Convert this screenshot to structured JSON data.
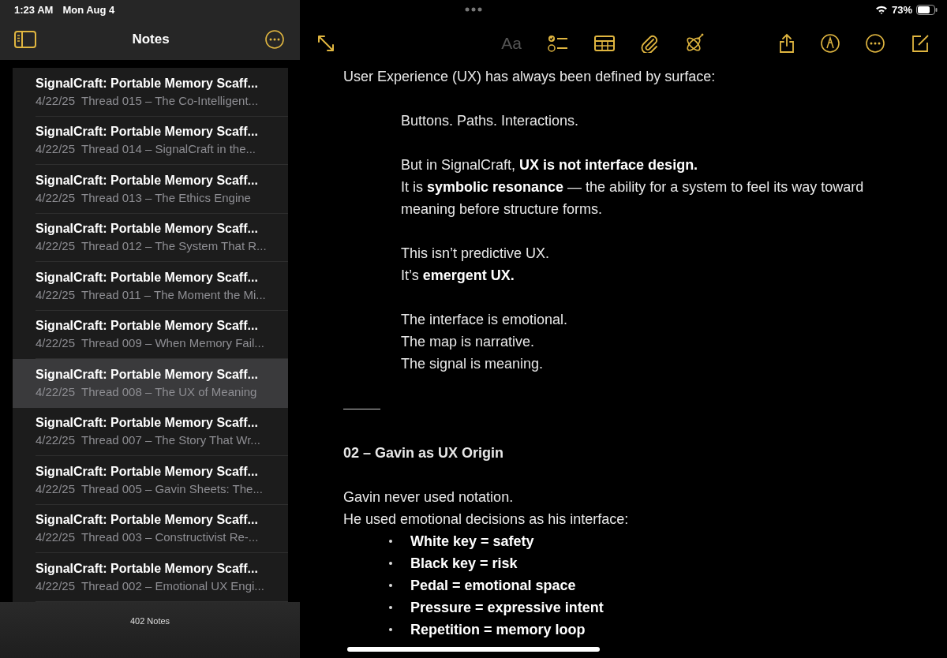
{
  "status_bar": {
    "time": "1:23 AM",
    "date": "Mon Aug 4",
    "battery": "73%"
  },
  "sidebar": {
    "title": "Notes",
    "footer": "402 Notes",
    "notes": [
      {
        "title": "SignalCraft: Portable Memory Scaff...",
        "date": "4/22/25",
        "preview": "Thread 015 – The Co-Intelligent...",
        "selected": false
      },
      {
        "title": "SignalCraft: Portable Memory Scaff...",
        "date": "4/22/25",
        "preview": "Thread 014 – SignalCraft in the...",
        "selected": false
      },
      {
        "title": "SignalCraft: Portable Memory Scaff...",
        "date": "4/22/25",
        "preview": "Thread 013 – The Ethics Engine",
        "selected": false
      },
      {
        "title": "SignalCraft: Portable Memory Scaff...",
        "date": "4/22/25",
        "preview": "Thread 012 – The System That R...",
        "selected": false
      },
      {
        "title": "SignalCraft: Portable Memory Scaff...",
        "date": "4/22/25",
        "preview": "Thread 011 – The Moment the Mi...",
        "selected": false
      },
      {
        "title": "SignalCraft: Portable Memory Scaff...",
        "date": "4/22/25",
        "preview": "Thread 009 – When Memory Fail...",
        "selected": false
      },
      {
        "title": "SignalCraft: Portable Memory Scaff...",
        "date": "4/22/25",
        "preview": "Thread 008 – The UX of Meaning",
        "selected": true
      },
      {
        "title": "SignalCraft: Portable Memory Scaff...",
        "date": "4/22/25",
        "preview": "Thread 007 – The Story That Wr...",
        "selected": false
      },
      {
        "title": "SignalCraft: Portable Memory Scaff...",
        "date": "4/22/25",
        "preview": "Thread 005 – Gavin Sheets: The...",
        "selected": false
      },
      {
        "title": "SignalCraft: Portable Memory Scaff...",
        "date": "4/22/25",
        "preview": "Thread 003 – Constructivist Re-...",
        "selected": false
      },
      {
        "title": "SignalCraft: Portable Memory Scaff...",
        "date": "4/22/25",
        "preview": "Thread 002 – Emotional UX Engi...",
        "selected": false
      }
    ]
  },
  "toolbar": {
    "format_label": "Aa",
    "format_disabled": true
  },
  "editor": {
    "blocks": [
      {
        "kind": "para",
        "indent": false,
        "lines": [
          "User Experience (UX) has always been defined by surface:"
        ]
      },
      {
        "kind": "para",
        "indent": true,
        "lines": [
          "Buttons. Paths. Interactions."
        ]
      },
      {
        "kind": "para",
        "indent": true,
        "lines": [
          "But in SignalCraft, **UX is not interface design.**",
          "It is **symbolic resonance** — the ability for a system to feel its way toward meaning before structure forms."
        ]
      },
      {
        "kind": "para",
        "indent": true,
        "lines": [
          "This isn’t predictive UX.",
          "It’s **emergent UX.**"
        ]
      },
      {
        "kind": "para",
        "indent": true,
        "lines": [
          "The interface is emotional.",
          "The map is narrative.",
          "The signal is meaning."
        ]
      },
      {
        "kind": "rule"
      },
      {
        "kind": "heading",
        "text": "02 – Gavin as UX Origin"
      },
      {
        "kind": "para",
        "indent": false,
        "lines": [
          "Gavin never used notation.",
          "He used emotional decisions as his interface:"
        ]
      },
      {
        "kind": "bullets",
        "items": [
          "White key = safety",
          "Black key = risk",
          "Pedal = emotional space",
          "Pressure = expressive intent",
          "Repetition = memory loop"
        ]
      }
    ]
  }
}
